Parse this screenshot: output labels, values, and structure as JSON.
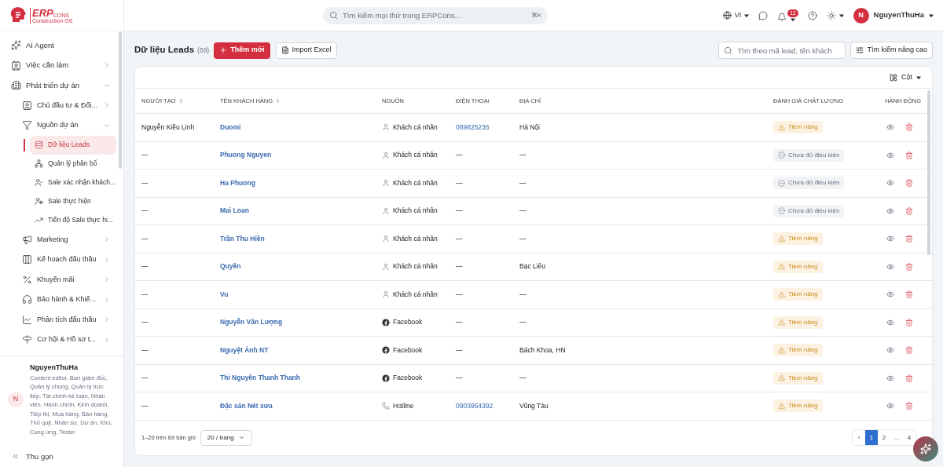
{
  "logo": {
    "brand": "ERP",
    "suffix": "CONS",
    "tagline": "Construction OS"
  },
  "header": {
    "search_placeholder": "Tìm kiếm mọi thứ trong ERPCons...",
    "shortcut": "⌘K",
    "language": "VI",
    "notification_count": "12",
    "user_initial": "N",
    "user_name": "NguyenThuHa"
  },
  "sidebar": {
    "items": [
      {
        "label": "AI Agent",
        "selected": false
      },
      {
        "label": "Việc cần làm",
        "selected": false,
        "expanded": false
      },
      {
        "label": "Phát triển dự án",
        "selected": false,
        "expanded": true,
        "children": [
          {
            "label": "Chủ đầu tư & Đối...",
            "selected": false,
            "expanded": false
          },
          {
            "label": "Nguồn dự án",
            "selected": false,
            "expanded": true,
            "children": [
              {
                "label": "Dữ liệu Leads",
                "selected": true
              },
              {
                "label": "Quản lý phân bổ",
                "selected": false
              },
              {
                "label": "Sale xác nhận khách...",
                "selected": false
              },
              {
                "label": "Sale thực hiện",
                "selected": false
              },
              {
                "label": "Tiến độ Sale thực hi...",
                "selected": false
              }
            ]
          },
          {
            "label": "Marketing",
            "selected": false,
            "expanded": false
          },
          {
            "label": "Kế hoạch đấu thầu",
            "selected": false,
            "expanded": false
          },
          {
            "label": "Khuyến mãi",
            "selected": false,
            "expanded": false
          },
          {
            "label": "Bảo hành & Khiế...",
            "selected": false,
            "expanded": false
          },
          {
            "label": "Phân tích đấu thầu",
            "selected": false,
            "expanded": false
          },
          {
            "label": "Cơ hội & Hồ sơ t...",
            "selected": false,
            "expanded": false
          }
        ]
      }
    ],
    "user": {
      "initial": "N",
      "name": "NguyenThuHa",
      "roles": "Content editor, Ban giám đốc, Quản lý chung, Quản lý trực tiếp, Tài chính kế toán, Nhân viên, Hành chính, Kinh doanh, Tiếp thị, Mua hàng, Bán hàng, Thủ quỹ, Nhân sự, Dự án, Kho, Cung ứng, Tester"
    },
    "collapse": "Thu gọn"
  },
  "page": {
    "title": "Dữ liệu Leads",
    "count": "(69)",
    "add_button": "Thêm mới",
    "import_button": "Import Excel",
    "search_placeholder": "Tìm theo mã lead, tên khách",
    "advanced_search": "Tìm kiếm nâng cao",
    "columns_button": "Cột"
  },
  "table": {
    "columns": [
      {
        "label": "NGƯỜI TẠO",
        "sortable": true
      },
      {
        "label": "TÊN KHÁCH HÀNG",
        "sortable": true
      },
      {
        "label": "NGUỒN",
        "sortable": false
      },
      {
        "label": "ĐIỆN THOẠI",
        "sortable": false
      },
      {
        "label": "ĐỊA CHỈ",
        "sortable": false
      },
      {
        "label": "ĐÁNH GIÁ CHẤT LƯỢNG",
        "sortable": false
      },
      {
        "label": "HÀNH ĐỘNG",
        "sortable": false
      }
    ],
    "rows": [
      {
        "creator": "Nguyễn Kiều Linh",
        "name": "Duomi",
        "source": {
          "kind": "person",
          "label": "Khách cá nhân"
        },
        "phone": "089825236",
        "address": "Hà Nội",
        "quality": {
          "kind": "potential",
          "label": "Tiềm năng"
        }
      },
      {
        "creator": "—",
        "name": "Phuong Nguyen",
        "source": {
          "kind": "person",
          "label": "Khách cá nhân"
        },
        "phone": "—",
        "address": "—",
        "quality": {
          "kind": "ineligible",
          "label": "Chưa đủ điều kiện"
        }
      },
      {
        "creator": "—",
        "name": "Ha Phuong",
        "source": {
          "kind": "person",
          "label": "Khách cá nhân"
        },
        "phone": "—",
        "address": "—",
        "quality": {
          "kind": "ineligible",
          "label": "Chưa đủ điều kiện"
        }
      },
      {
        "creator": "—",
        "name": "Mai Loan",
        "source": {
          "kind": "person",
          "label": "Khách cá nhân"
        },
        "phone": "—",
        "address": "—",
        "quality": {
          "kind": "ineligible",
          "label": "Chưa đủ điều kiện"
        }
      },
      {
        "creator": "—",
        "name": "Trần Thu Hiền",
        "source": {
          "kind": "person",
          "label": "Khách cá nhân"
        },
        "phone": "—",
        "address": "—",
        "quality": {
          "kind": "potential",
          "label": "Tiềm năng"
        }
      },
      {
        "creator": "—",
        "name": "Quyền",
        "source": {
          "kind": "person",
          "label": "Khách cá nhân"
        },
        "phone": "—",
        "address": "Bạc Liêu",
        "quality": {
          "kind": "potential",
          "label": "Tiềm năng"
        }
      },
      {
        "creator": "—",
        "name": "Vu",
        "source": {
          "kind": "person",
          "label": "Khách cá nhân"
        },
        "phone": "—",
        "address": "—",
        "quality": {
          "kind": "potential",
          "label": "Tiềm năng"
        }
      },
      {
        "creator": "—",
        "name": "Nguyễn Văn Lượng",
        "source": {
          "kind": "facebook",
          "label": "Facebook"
        },
        "phone": "—",
        "address": "—",
        "quality": {
          "kind": "potential",
          "label": "Tiềm năng"
        }
      },
      {
        "creator": "—",
        "name": "Nguyệt Ánh NT",
        "source": {
          "kind": "facebook",
          "label": "Facebook"
        },
        "phone": "—",
        "address": "Bách Khoa, HN",
        "quality": {
          "kind": "potential",
          "label": "Tiềm năng"
        }
      },
      {
        "creator": "—",
        "name": "Thi Nguyên Thanh Thanh",
        "source": {
          "kind": "facebook",
          "label": "Facebook"
        },
        "phone": "—",
        "address": "—",
        "quality": {
          "kind": "potential",
          "label": "Tiềm năng"
        }
      },
      {
        "creator": "—",
        "name": "Đặc sản Nét xưa",
        "source": {
          "kind": "phone",
          "label": "Hotline"
        },
        "phone": "0903954392",
        "address": "Vũng Tàu",
        "quality": {
          "kind": "potential",
          "label": "Tiềm năng"
        }
      }
    ]
  },
  "footer": {
    "summary": "1–20 trên 69 bản ghi",
    "page_size": "20 / trang",
    "pages": [
      {
        "label": "‹",
        "selected": false
      },
      {
        "label": "1",
        "selected": true
      },
      {
        "label": "2",
        "selected": false
      },
      {
        "label": "...",
        "selected": false
      },
      {
        "label": "4",
        "selected": false
      }
    ]
  }
}
